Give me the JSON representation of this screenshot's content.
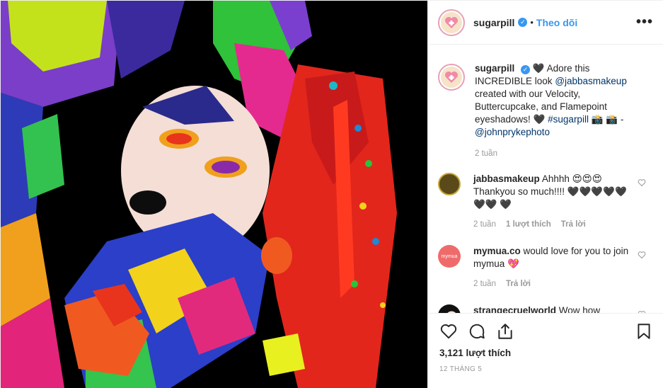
{
  "post": {
    "author": "sugarpill",
    "follow_label": "Theo dõi",
    "separator": "•",
    "more_label": "•••"
  },
  "caption": {
    "username": "sugarpill",
    "emoji_lead": "🖤",
    "text_1": "Adore this INCREDIBLE look",
    "mention_1": "@jabbasmakeup",
    "text_2": "created with our Velocity, Buttercupcake, and Flamepoint eyeshadows!",
    "emoji_mid": "🖤",
    "hashtag": "#sugarpill",
    "emoji_tail": "📸 📸 -",
    "mention_2": "@johnprykephoto",
    "time": "2 tuần"
  },
  "comments": [
    {
      "username": "jabbasmakeup",
      "text": "Ahhhh 😍😍😍 Thankyou so much!!!! 🖤🖤🖤🖤🖤🖤🖤 🖤",
      "time": "2 tuần",
      "likes": "1 lượt thích",
      "reply": "Trả lời"
    },
    {
      "username": "mymua.co",
      "avatar_text": "mymua",
      "text": "would love for you to join mymua 💖",
      "time": "2 tuần",
      "reply": "Trả lời"
    },
    {
      "username": "strangecruelworld",
      "text": "Wow how"
    }
  ],
  "footer": {
    "likes": "3,121 lượt thích",
    "date": "12 THÁNG 5"
  },
  "colors": {
    "accent": "#3897f0",
    "link": "#003569",
    "muted": "#999999",
    "mymua_avatar": "#ef6b6b"
  },
  "icons": [
    "heart-icon",
    "comment-icon",
    "share-icon",
    "bookmark-icon",
    "verified-badge-icon",
    "more-options-icon",
    "like-comment-icon"
  ]
}
